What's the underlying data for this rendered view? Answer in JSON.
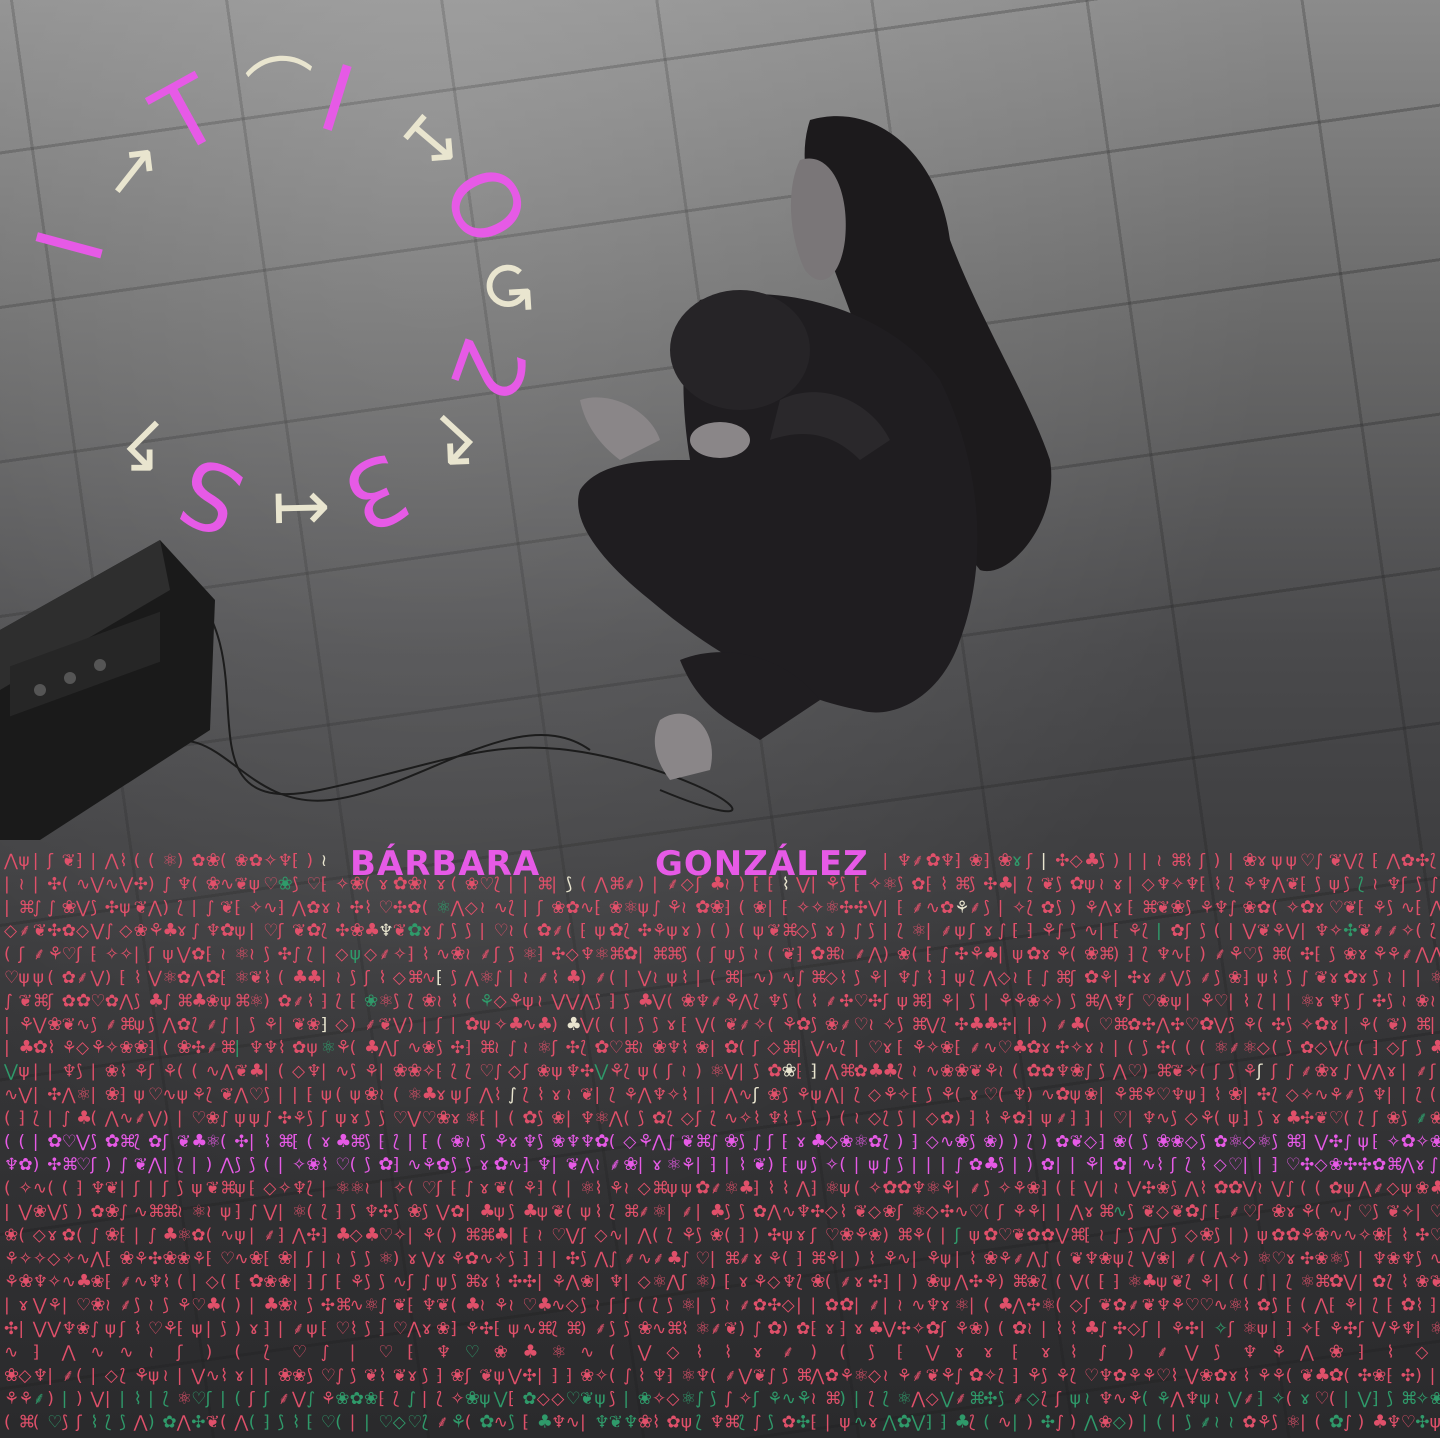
{
  "title_letters": [
    {
      "char": "I",
      "tone": "pink"
    },
    {
      "char": "→",
      "tone": "cream"
    },
    {
      "char": "T",
      "tone": "pink"
    },
    {
      "char": "⌒",
      "tone": "cream"
    },
    {
      "char": "I",
      "tone": "pink"
    },
    {
      "char": "↦",
      "tone": "cream"
    },
    {
      "char": "O",
      "tone": "pink"
    },
    {
      "char": "↺",
      "tone": "cream"
    },
    {
      "char": "2",
      "tone": "pink"
    },
    {
      "char": "↱",
      "tone": "cream"
    },
    {
      "char": "3",
      "tone": "pink"
    },
    {
      "char": "↤",
      "tone": "cream"
    },
    {
      "char": "S",
      "tone": "pink"
    },
    {
      "char": "↰",
      "tone": "cream"
    }
  ],
  "artist": {
    "first_name": "BÁRBARA",
    "last_name": "GONZÁLEZ"
  },
  "colors": {
    "accent_pink": "#e65ae6",
    "cream": "#e9e5cf",
    "pattern_red": "#e0506a",
    "pattern_green": "#2f9a6a"
  },
  "pattern_glyphs": "⁅⁆ʃ⟆ɤ❦⚘✿⟅⟆(()|||ψ⋀⋁∿◇♡⌘✣✧⸙❀♆⚛∫≀⌇",
  "pattern_highlight_glyphs": "✿❀⚘♣"
}
